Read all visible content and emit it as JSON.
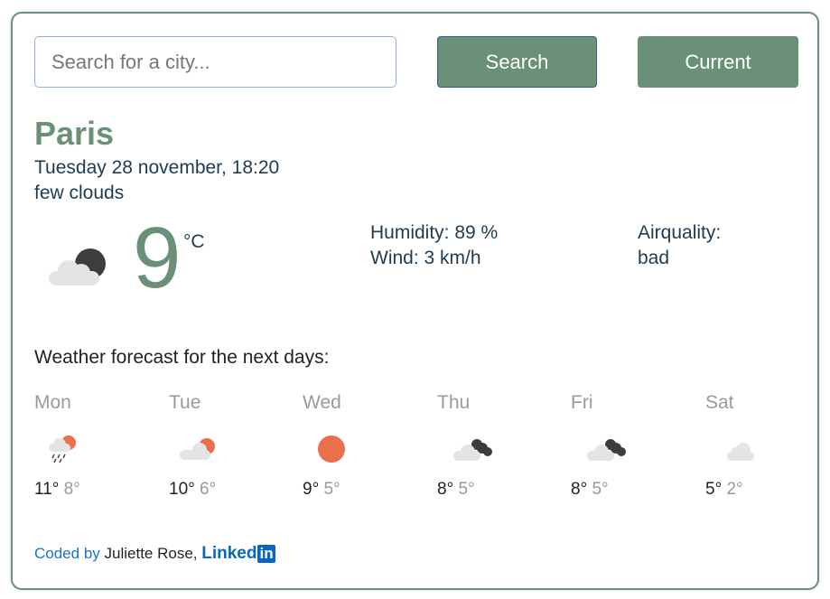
{
  "search": {
    "placeholder": "Search for a city...",
    "value": ""
  },
  "buttons": {
    "search_label": "Search",
    "current_label": "Current"
  },
  "current": {
    "city": "Paris",
    "date": "Tuesday 28 november, 18:20",
    "description": "few clouds",
    "temperature": "9",
    "unit": "°C",
    "icon": "few-clouds-night-icon",
    "humidity": "Humidity: 89 %",
    "wind": "Wind: 3 km/h",
    "airquality_label": "Airquality:",
    "airquality_value": "bad"
  },
  "forecast": {
    "title": "Weather forecast for the next days:",
    "days": [
      {
        "name": "Mon",
        "max": "11°",
        "min": "8°",
        "icon": "rain-cloud-sun-icon"
      },
      {
        "name": "Tue",
        "max": "10°",
        "min": "6°",
        "icon": "cloud-sun-icon"
      },
      {
        "name": "Wed",
        "max": "9°",
        "min": "5°",
        "icon": "sun-icon"
      },
      {
        "name": "Thu",
        "max": "8°",
        "min": "5°",
        "icon": "cloud-dark-clouds-icon"
      },
      {
        "name": "Fri",
        "max": "8°",
        "min": "5°",
        "icon": "cloud-dark-clouds-icon"
      },
      {
        "name": "Sat",
        "max": "5°",
        "min": "2°",
        "icon": "cloud-icon"
      }
    ]
  },
  "footer": {
    "coded_by": "Coded by",
    "author": "Juliette Rose,",
    "linkedin_text": "Linked",
    "linkedin_in": "in"
  },
  "colors": {
    "accent": "#6b9078",
    "text": "#1f3b50",
    "sun": "#ec6e4c",
    "link": "#1a73c8"
  }
}
